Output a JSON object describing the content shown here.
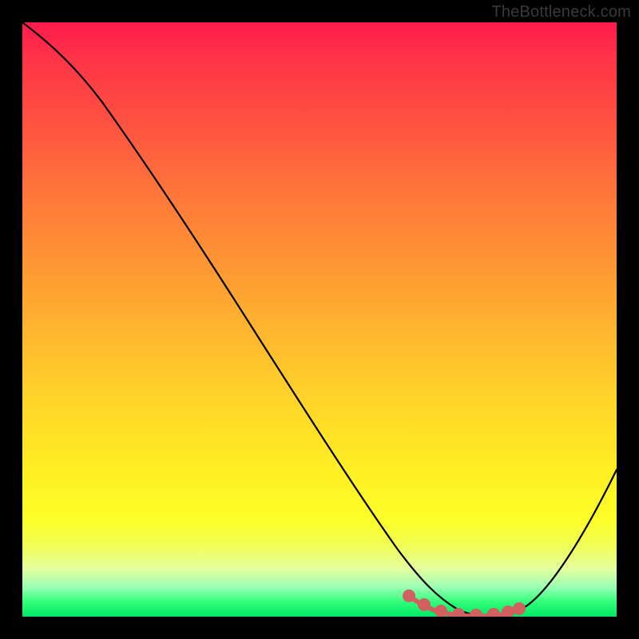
{
  "watermark": {
    "text": "TheBottleneck.com"
  },
  "chart_data": {
    "type": "line",
    "title": "",
    "xlabel": "",
    "ylabel": "",
    "xlim": [
      0,
      100
    ],
    "ylim": [
      0,
      100
    ],
    "grid": false,
    "legend": false,
    "series": [
      {
        "name": "curve",
        "color": "#000000",
        "x": [
          0,
          4,
          9,
          14,
          20,
          27,
          34,
          41,
          48,
          55,
          60,
          64,
          67,
          70,
          73,
          76,
          79,
          82,
          85,
          89,
          93,
          97,
          100
        ],
        "values": [
          100,
          97,
          93,
          88,
          81,
          72,
          62,
          52,
          42,
          32,
          24,
          17,
          11,
          6,
          3,
          1,
          0,
          0,
          1,
          4,
          10,
          18,
          26
        ]
      },
      {
        "name": "highlight",
        "color": "#d16060",
        "x": [
          65,
          67.5,
          70,
          72.5,
          75,
          77.5,
          80,
          82.5
        ],
        "values": [
          3.5,
          2.4,
          1.6,
          1.0,
          0.7,
          0.7,
          0.9,
          1.5
        ]
      }
    ],
    "gradient_stops": [
      {
        "pos": 0,
        "color": "#ff1a4d"
      },
      {
        "pos": 6,
        "color": "#ff3347"
      },
      {
        "pos": 18,
        "color": "#ff5540"
      },
      {
        "pos": 30,
        "color": "#ff7a3a"
      },
      {
        "pos": 42,
        "color": "#ff9a33"
      },
      {
        "pos": 54,
        "color": "#ffbb2e"
      },
      {
        "pos": 65,
        "color": "#ffd828"
      },
      {
        "pos": 76,
        "color": "#fff023"
      },
      {
        "pos": 84,
        "color": "#fdff2a"
      },
      {
        "pos": 88,
        "color": "#f1ff55"
      },
      {
        "pos": 92,
        "color": "#e4ffa0"
      },
      {
        "pos": 95,
        "color": "#9cffb5"
      },
      {
        "pos": 97.5,
        "color": "#32ff7a"
      },
      {
        "pos": 100,
        "color": "#00e765"
      }
    ]
  }
}
